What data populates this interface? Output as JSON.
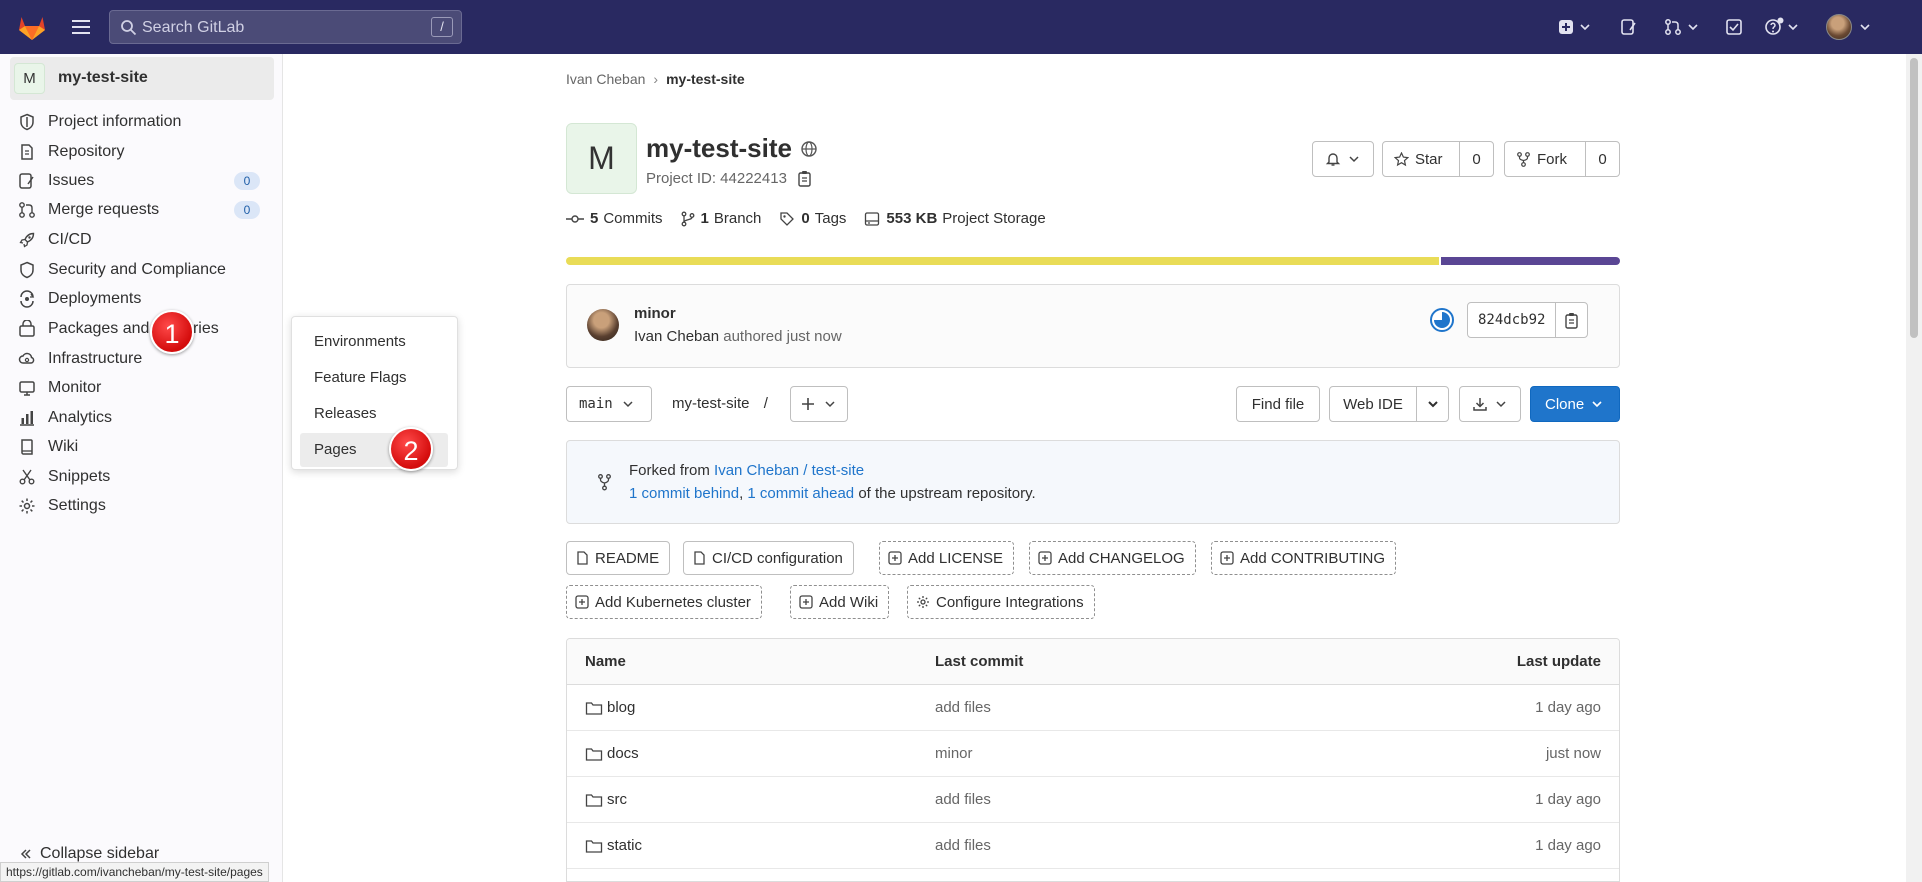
{
  "topbar": {
    "search_placeholder": "Search GitLab",
    "search_shortcut": "/",
    "colors": {
      "bg": "#292961"
    }
  },
  "sidebar": {
    "project_avatar": "M",
    "project_name": "my-test-site",
    "items": [
      {
        "label": "Project information",
        "icon": "info-icon"
      },
      {
        "label": "Repository",
        "icon": "doc-icon"
      },
      {
        "label": "Issues",
        "icon": "issues-icon",
        "count": "0"
      },
      {
        "label": "Merge requests",
        "icon": "merge-request-icon",
        "count": "0"
      },
      {
        "label": "CI/CD",
        "icon": "rocket-icon"
      },
      {
        "label": "Security and Compliance",
        "icon": "shield-icon"
      },
      {
        "label": "Deployments",
        "icon": "deployments-icon"
      },
      {
        "label": "Packages and registries",
        "icon": "package-icon"
      },
      {
        "label": "Infrastructure",
        "icon": "cloud-gear-icon"
      },
      {
        "label": "Monitor",
        "icon": "monitor-icon"
      },
      {
        "label": "Analytics",
        "icon": "chart-icon"
      },
      {
        "label": "Wiki",
        "icon": "book-icon"
      },
      {
        "label": "Snippets",
        "icon": "scissors-icon"
      },
      {
        "label": "Settings",
        "icon": "gear-icon"
      }
    ],
    "collapse_label": "Collapse sidebar"
  },
  "status_url": "https://gitlab.com/ivancheban/my-test-site/pages",
  "flyout": {
    "items": [
      "Environments",
      "Feature Flags",
      "Releases",
      "Pages"
    ],
    "active": "Pages"
  },
  "steps": {
    "one": "1",
    "two": "2"
  },
  "breadcrumb": {
    "parent": "Ivan Cheban",
    "current": "my-test-site"
  },
  "project": {
    "avatar": "M",
    "title": "my-test-site",
    "id_label": "Project ID: 44222413",
    "star_label": "Star",
    "star_count": "0",
    "fork_label": "Fork",
    "fork_count": "0"
  },
  "stats": {
    "commits_num": "5",
    "commits_label": "Commits",
    "branch_num": "1",
    "branch_label": "Branch",
    "tags_num": "0",
    "tags_label": "Tags",
    "storage_num": "553 KB",
    "storage_label": "Project Storage"
  },
  "storage_bar": {
    "segments": [
      {
        "fraction": 0.83,
        "color": "#e9dc57"
      },
      {
        "fraction": 0.17,
        "color": "#5a4694"
      }
    ]
  },
  "last_commit": {
    "title": "minor",
    "author": "Ivan Cheban",
    "action": "authored just now",
    "sha": "824dcb92"
  },
  "repo_nav": {
    "branch": "main",
    "path": "my-test-site",
    "path_sep": "/",
    "find_file": "Find file",
    "web_ide": "Web IDE",
    "clone": "Clone",
    "colors": {
      "primary": "#1f75cb"
    }
  },
  "fork_info": {
    "prefix": "Forked from",
    "source": "Ivan Cheban / test-site",
    "behind": "1 commit behind",
    "comma": ",",
    "ahead": "1 commit ahead",
    "suffix": "of the upstream repository."
  },
  "quick_actions": [
    {
      "label": "README",
      "style": "solid",
      "icon": "doc-icon"
    },
    {
      "label": "CI/CD configuration",
      "style": "solid",
      "icon": "doc-icon"
    },
    {
      "label": "Add LICENSE",
      "style": "dashed",
      "icon": "plus-square-icon"
    },
    {
      "label": "Add CHANGELOG",
      "style": "dashed",
      "icon": "plus-square-icon"
    },
    {
      "label": "Add CONTRIBUTING",
      "style": "dashed",
      "icon": "plus-square-icon"
    },
    {
      "label": "Add Kubernetes cluster",
      "style": "dashed",
      "icon": "plus-square-icon"
    },
    {
      "label": "Add Wiki",
      "style": "dashed",
      "icon": "plus-square-icon"
    },
    {
      "label": "Configure Integrations",
      "style": "dashed",
      "icon": "gear-icon"
    }
  ],
  "files": {
    "headers": [
      "Name",
      "Last commit",
      "Last update"
    ],
    "rows": [
      {
        "name": "blog",
        "commit": "add files",
        "updated": "1 day ago"
      },
      {
        "name": "docs",
        "commit": "minor",
        "updated": "just now"
      },
      {
        "name": "src",
        "commit": "add files",
        "updated": "1 day ago"
      },
      {
        "name": "static",
        "commit": "add files",
        "updated": "1 day ago"
      }
    ]
  }
}
